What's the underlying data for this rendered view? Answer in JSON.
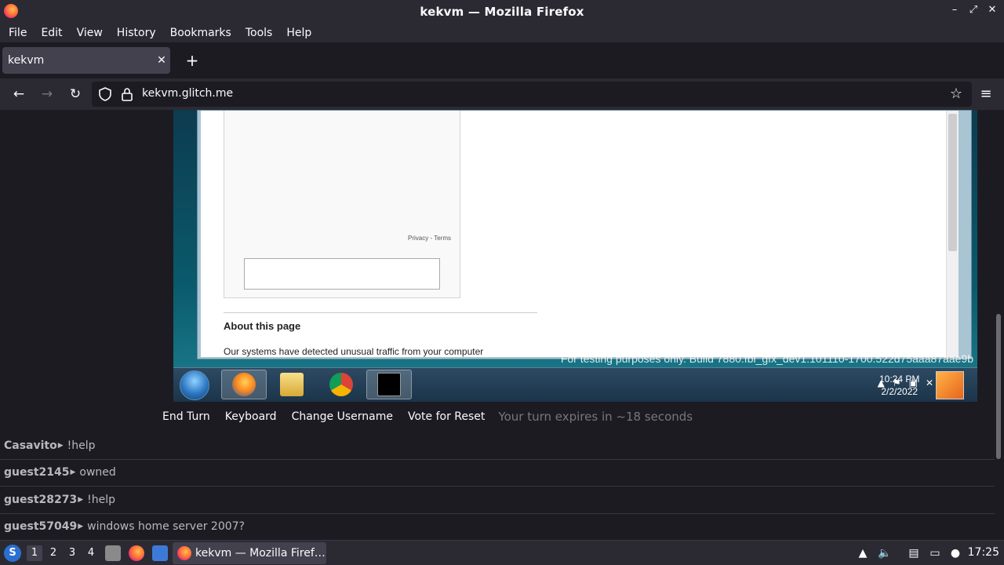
{
  "window": {
    "title": "kekvm — Mozilla Firefox"
  },
  "menubar": {
    "items": [
      "File",
      "Edit",
      "View",
      "History",
      "Bookmarks",
      "Tools",
      "Help"
    ]
  },
  "tabs": [
    {
      "label": "kekvm",
      "active": true
    }
  ],
  "navbar": {
    "url": "kekvm.glitch.me"
  },
  "vm": {
    "captcha_links": "Privacy - Terms",
    "about_heading": "About this page",
    "about_text": "Our systems have detected unusual traffic from your computer",
    "watermark": "For testing purposes only. Build 7880.fbl_gfx_dev1.101110-1700.522d75aaa87aae9b",
    "clock_time": "10:24 PM",
    "clock_date": "2/2/2022"
  },
  "controls": {
    "end_turn": "End Turn",
    "keyboard": "Keyboard",
    "change_username": "Change Username",
    "vote_reset": "Vote for Reset",
    "turn_status": "Your turn expires in ~18 seconds"
  },
  "chat": [
    {
      "user": "Casavito",
      "msg": "!help"
    },
    {
      "user": "guest2145",
      "msg": "owned"
    },
    {
      "user": "guest28273",
      "msg": "!help"
    },
    {
      "user": "guest57049",
      "msg": "windows home server 2007?"
    }
  ],
  "os_taskbar": {
    "workspaces": [
      "1",
      "2",
      "3",
      "4"
    ],
    "active_task": "kekvm — Mozilla Firef…",
    "clock": "17:25"
  }
}
